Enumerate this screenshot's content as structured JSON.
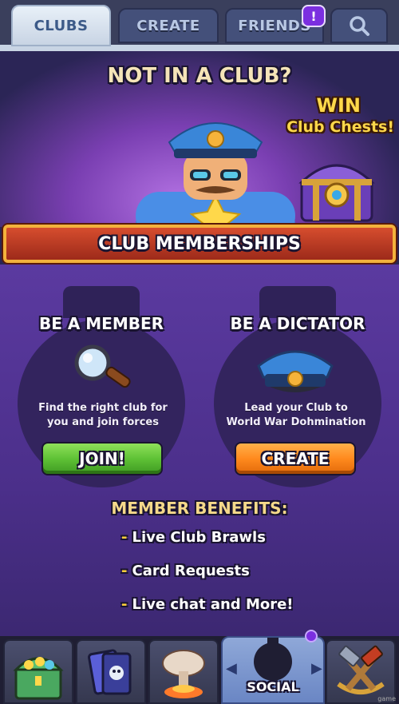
{
  "tabs": {
    "clubs": "CLUBS",
    "create": "CREATE",
    "friends": "FRIENDS",
    "friends_badge": "!"
  },
  "hero": {
    "title": "NOT IN A CLUB?",
    "win": "WIN",
    "chests": "Club Chests!"
  },
  "banner": "CLUB MEMBERSHIPS",
  "member": {
    "title": "BE A MEMBER",
    "desc_line1": "Find the right club for",
    "desc_line2": "you and join forces",
    "button": "JOIN!"
  },
  "dictator": {
    "title": "BE A DICTATOR",
    "desc_line1": "Lead your Club to",
    "desc_line2": "World War Dohmination",
    "button": "CREATE"
  },
  "benefits": {
    "title": "MEMBER BENEFITS:",
    "items": [
      "Live Club Brawls",
      "Card Requests",
      "Live chat and More!"
    ],
    "bullet": "-"
  },
  "bottom_nav": {
    "social": "SOCIAL",
    "icons": [
      "treasure-chest-icon",
      "cards-icon",
      "mushroom-cloud-icon",
      "social-icon",
      "crossed-hammers-icon"
    ]
  },
  "colors": {
    "join_green": "#5fc236",
    "create_orange": "#ff8a1e",
    "banner_red": "#c43d22",
    "section_purple": "#4b2f8a"
  },
  "watermark": "game"
}
